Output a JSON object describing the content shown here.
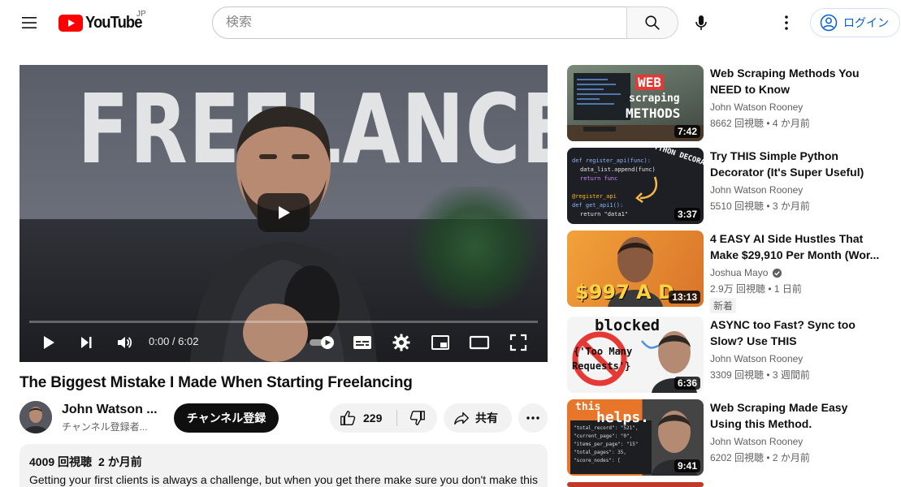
{
  "header": {
    "logo_text": "YouTube",
    "logo_country": "JP",
    "search_placeholder": "検索",
    "login_label": "ログイン"
  },
  "player": {
    "thumbnail_word": "FREELANCE?",
    "time_current": "0:00",
    "time_total": "6:02",
    "time_readout": "0:00 / 6:02",
    "progress": 0
  },
  "video": {
    "title": "The Biggest Mistake I Made When Starting Freelancing",
    "channel_name": "John Watson ...",
    "channel_subs": "チャンネル登録者...",
    "subscribe_label": "チャンネル登録",
    "like_count": "229",
    "share_label": "共有",
    "views": "4009 回視聴",
    "age": "2 か月前",
    "description": "Getting your first clients is always a challenge, but when you get there make sure you don't make this"
  },
  "recommendations": [
    {
      "title": "Web Scraping Methods You NEED to Know",
      "channel": "John Watson Rooney",
      "meta": "8662 回視聴 • 4 か月前",
      "duration": "7:42",
      "thumb_text": [
        "WEB",
        "scraping",
        "METHODS"
      ]
    },
    {
      "title": "Try THIS Simple Python Decorator (It's Super Useful)",
      "channel": "John Watson Rooney",
      "meta": "5510 回視聴 • 3 か月前",
      "duration": "3:37",
      "thumb_text": [
        "PYTHON DECORATOR",
        "def register_api(func):",
        "data_list.append(func)",
        "return func",
        "@register_api",
        "def get_api1():",
        "return \"data1\""
      ]
    },
    {
      "title": "4 EASY AI Side Hustles That Make $29,910 Per Month (Wor...",
      "channel": "Joshua Mayo",
      "meta": "2.9万 回視聴 • 1 日前",
      "badge": "新着",
      "duration": "13:13",
      "thumb_text": [
        "$997 A D"
      ]
    },
    {
      "title": "ASYNC too Fast? Sync too Slow? Use THIS",
      "channel": "John Watson Rooney",
      "meta": "3309 回視聴 • 3 週間前",
      "duration": "6:36",
      "thumb_text": [
        "blocked",
        "{'Too Many",
        "Requests'}"
      ]
    },
    {
      "title": "Web Scraping Made Easy Using this Method.",
      "channel": "John Watson Rooney",
      "meta": "6202 回視聴 • 2 か月前",
      "duration": "9:41",
      "thumb_text": [
        "this",
        "helps.",
        "\"total_record\": \"521\",",
        "\"current_page\": \"0\",",
        "\"items_per_page\": \"15\"",
        "\"total_pages\": 35,",
        "\"score_nodes\": ["
      ]
    }
  ],
  "colors": {
    "brand_red": "#ff0000",
    "link_blue": "#065fd4",
    "text": "#0f0f0f",
    "secondary": "#606060"
  }
}
